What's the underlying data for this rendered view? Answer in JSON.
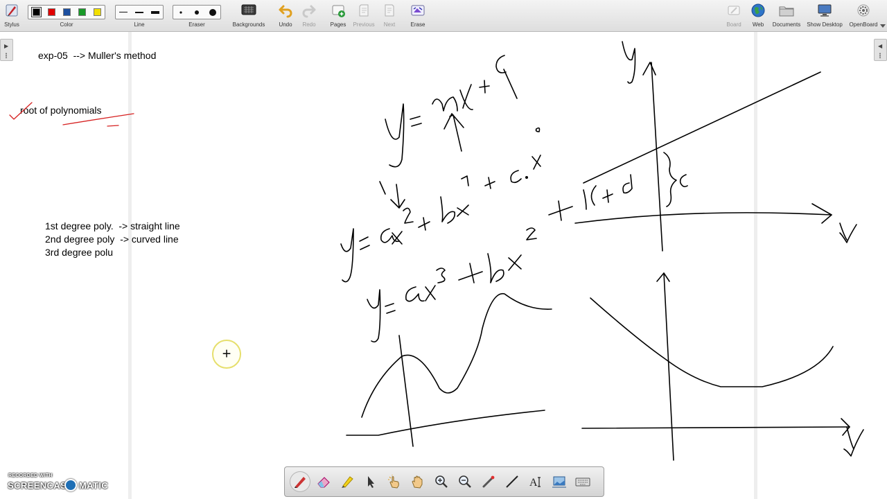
{
  "toolbar": {
    "stylus": "Stylus",
    "color": "Color",
    "line": "Line",
    "eraser": "Eraser",
    "backgrounds": "Backgrounds",
    "undo": "Undo",
    "redo": "Redo",
    "pages": "Pages",
    "previous": "Previous",
    "next": "Next",
    "erase": "Erase",
    "board": "Board",
    "web": "Web",
    "documents": "Documents",
    "show_desktop": "Show Desktop",
    "openboard": "OpenBoard",
    "colors": [
      "#000000",
      "#e00000",
      "#1d4fa0",
      "#1a9a2a",
      "#f2e000"
    ],
    "selected_color": "#000000"
  },
  "page": {
    "title_line": "exp-05  --> Muller's method",
    "subtitle": "root of polynomials",
    "notes": [
      "1st degree poly.  -> straight line",
      "2nd degree poly  -> curved line",
      "3rd degree polu"
    ]
  },
  "bottom_tools": [
    {
      "name": "pen-tool-icon",
      "active": true
    },
    {
      "name": "eraser-tool-icon"
    },
    {
      "name": "marker-tool-icon"
    },
    {
      "name": "selector-tool-icon"
    },
    {
      "name": "interact-hand-icon"
    },
    {
      "name": "pan-hand-icon"
    },
    {
      "name": "zoom-in-icon"
    },
    {
      "name": "zoom-out-icon"
    },
    {
      "name": "laser-pointer-icon"
    },
    {
      "name": "line-tool-icon"
    },
    {
      "name": "text-tool-icon"
    },
    {
      "name": "capture-tool-icon"
    },
    {
      "name": "virtual-keyboard-icon"
    }
  ],
  "watermark": {
    "top": "RECORDED WITH",
    "brand_left": "SCREENCAST",
    "brand_right": "MATIC"
  },
  "colors": {
    "toolbar_bg": "#e4e4e4",
    "ink": "#000000",
    "check_ink": "#d62020",
    "cursor_halo": "#e6df6c"
  }
}
